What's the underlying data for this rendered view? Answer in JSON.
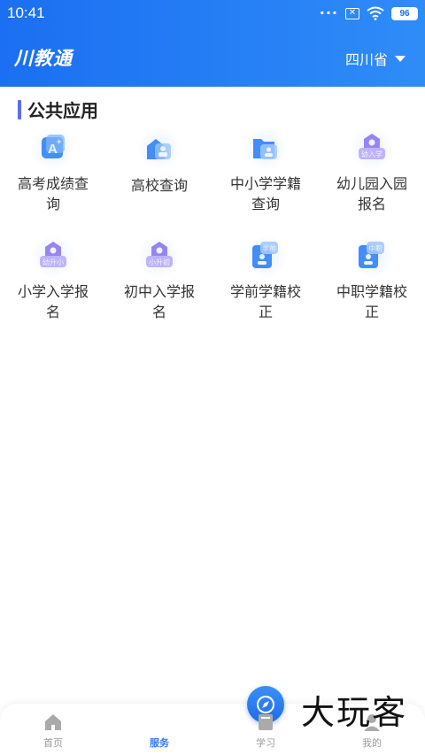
{
  "status_bar": {
    "time": "10:41",
    "battery": "96"
  },
  "header": {
    "app_title": "川教通",
    "province": "四川省"
  },
  "section": {
    "title": "公共应用"
  },
  "apps": [
    {
      "label": "高考成绩查询",
      "icon": "grade-A-icon"
    },
    {
      "label": "高校查询",
      "icon": "university-icon"
    },
    {
      "label": "中小学学籍查询",
      "icon": "folder-person-icon"
    },
    {
      "label": "幼儿园入园报名",
      "icon": "kindergarten-badge-icon",
      "badge": "幼入学"
    },
    {
      "label": "小学入学报名",
      "icon": "primary-badge-icon",
      "badge": "幼升小"
    },
    {
      "label": "初中入学报名",
      "icon": "junior-badge-icon",
      "badge": "小升初"
    },
    {
      "label": "学前学籍校正",
      "icon": "preschool-card-icon",
      "badge": "学前"
    },
    {
      "label": "中职学籍校正",
      "icon": "vocational-card-icon",
      "badge": "中职"
    }
  ],
  "tabbar": {
    "items": [
      {
        "label": "首页",
        "icon": "home-icon"
      },
      {
        "label": "服务",
        "icon": "compass-icon",
        "active": true
      },
      {
        "label": "学习",
        "icon": "book-icon"
      },
      {
        "label": "我的",
        "icon": "user-icon"
      }
    ]
  },
  "watermark": "大玩客",
  "colors": {
    "primary": "#1b6ff2",
    "accent_bar": "#5a6df0",
    "purple": "#a88cf0"
  }
}
